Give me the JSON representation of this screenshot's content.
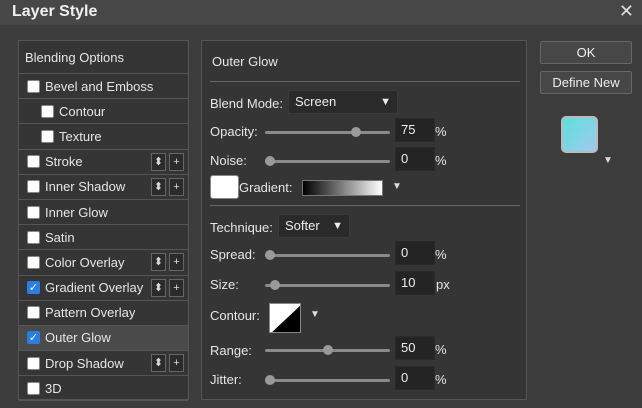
{
  "window": {
    "title": "Layer Style",
    "close_glyph": "✕"
  },
  "left_panel": {
    "header": "Blending Options",
    "items": [
      {
        "label": "Bevel and Emboss",
        "checked": false,
        "sub": false,
        "buttons": false,
        "selected": false
      },
      {
        "label": "Contour",
        "checked": false,
        "sub": true,
        "buttons": false,
        "selected": false
      },
      {
        "label": "Texture",
        "checked": false,
        "sub": true,
        "buttons": false,
        "selected": false
      },
      {
        "label": "Stroke",
        "checked": false,
        "sub": false,
        "buttons": true,
        "selected": false
      },
      {
        "label": "Inner Shadow",
        "checked": false,
        "sub": false,
        "buttons": true,
        "selected": false
      },
      {
        "label": "Inner Glow",
        "checked": false,
        "sub": false,
        "buttons": false,
        "selected": false
      },
      {
        "label": "Satin",
        "checked": false,
        "sub": false,
        "buttons": false,
        "selected": false
      },
      {
        "label": "Color Overlay",
        "checked": false,
        "sub": false,
        "buttons": true,
        "selected": false
      },
      {
        "label": "Gradient Overlay",
        "checked": true,
        "sub": false,
        "buttons": true,
        "selected": false
      },
      {
        "label": "Pattern Overlay",
        "checked": false,
        "sub": false,
        "buttons": false,
        "selected": false
      },
      {
        "label": "Outer Glow",
        "checked": true,
        "sub": false,
        "buttons": false,
        "selected": true
      },
      {
        "label": "Drop Shadow",
        "checked": false,
        "sub": false,
        "buttons": true,
        "selected": false
      },
      {
        "label": "3D",
        "checked": false,
        "sub": false,
        "buttons": false,
        "selected": false
      }
    ],
    "mini_button_icons": {
      "reorder": "⬍",
      "add": "+"
    }
  },
  "outer_glow": {
    "title": "Outer Glow",
    "blend_mode_label": "Blend Mode:",
    "blend_mode_value": "Screen",
    "opacity_label": "Opacity:",
    "opacity_value": "75",
    "opacity_fraction": 0.75,
    "noise_label": "Noise:",
    "noise_value": "0",
    "noise_fraction": 0.0,
    "gradient_label": "Gradient:",
    "technique_label": "Technique:",
    "technique_value": "Softer",
    "spread_label": "Spread:",
    "spread_value": "0",
    "spread_fraction": 0.0,
    "size_label": "Size:",
    "size_value": "10",
    "size_fraction": 0.04,
    "contour_label": "Contour:",
    "range_label": "Range:",
    "range_value": "50",
    "range_fraction": 0.5,
    "jitter_label": "Jitter:",
    "jitter_value": "0",
    "jitter_fraction": 0.0,
    "unit_percent": "%",
    "unit_px": "px"
  },
  "actions": {
    "ok_label": "OK",
    "define_new_label": "Define New"
  },
  "colors": {
    "accent": "#2a7de1",
    "preview_start": "#5de0d8",
    "preview_end": "#9fc9f0"
  }
}
